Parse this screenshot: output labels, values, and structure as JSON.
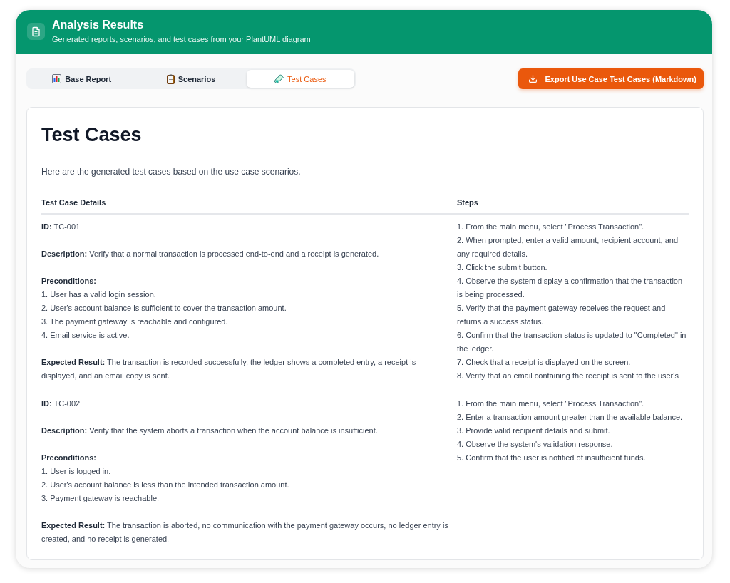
{
  "header": {
    "title": "Analysis Results",
    "subtitle": "Generated reports, scenarios, and test cases from your PlantUML diagram"
  },
  "tabs": [
    {
      "label": "Base Report",
      "selected": false
    },
    {
      "label": "Scenarios",
      "selected": false
    },
    {
      "label": "Test Cases",
      "selected": true
    }
  ],
  "export_button": {
    "label": "Export Use Case Test Cases (Markdown)"
  },
  "content": {
    "title": "Test Cases",
    "intro": "Here are the generated test cases based on the use case scenarios.",
    "table": {
      "columns": [
        "Test Case Details",
        "Steps"
      ],
      "rows": [
        {
          "id": "**ID:** TC-001",
          "description": "**Description:** Verify that a normal transaction is processed end-to-end and a receipt is generated.",
          "preconditions_heading": "Preconditions:",
          "preconditions": [
            "1. User has a valid login session.",
            "2. User's account balance is sufficient to cover the transaction amount.",
            "3. The payment gateway is reachable and configured.",
            "4. Email service is active."
          ],
          "expected_result": "**Expected Result:** The transaction is recorded successfully, the ledger shows a completed entry, a receipt is displayed, and an email copy is sent.",
          "steps": [
            "1. From the main menu, select \"Process Transaction\".",
            "2. When prompted, enter a valid amount, recipient account, and any required details.",
            "3. Click the submit button.",
            "4. Observe the system display a confirmation that the transaction is being processed.",
            "5. Verify that the payment gateway receives the request and returns a success status.",
            "6. Confirm that the transaction status is updated to \"Completed\" in the ledger.",
            "7. Check that a receipt is displayed on the screen.",
            "8. Verify that an email containing the receipt is sent to the user's"
          ]
        },
        {
          "id": "**ID:** TC-002",
          "description": "**Description:** Verify that the system aborts a transaction when the account balance is insufficient.",
          "preconditions_heading": "Preconditions:",
          "preconditions": [
            "1. User is logged in.",
            "2. User's account balance is less than the intended transaction amount.",
            "3. Payment gateway is reachable."
          ],
          "expected_result": "**Expected Result:** The transaction is aborted, no communication with the payment gateway occurs, no ledger entry is created, and no receipt is generated.",
          "steps": [
            "1. From the main menu, select \"Process Transaction\".",
            "2. Enter a transaction amount greater than the available balance.",
            "3. Provide valid recipient details and submit.",
            "4. Observe the system's validation response.",
            "5. Confirm that the user is notified of insufficient funds."
          ]
        }
      ]
    }
  }
}
